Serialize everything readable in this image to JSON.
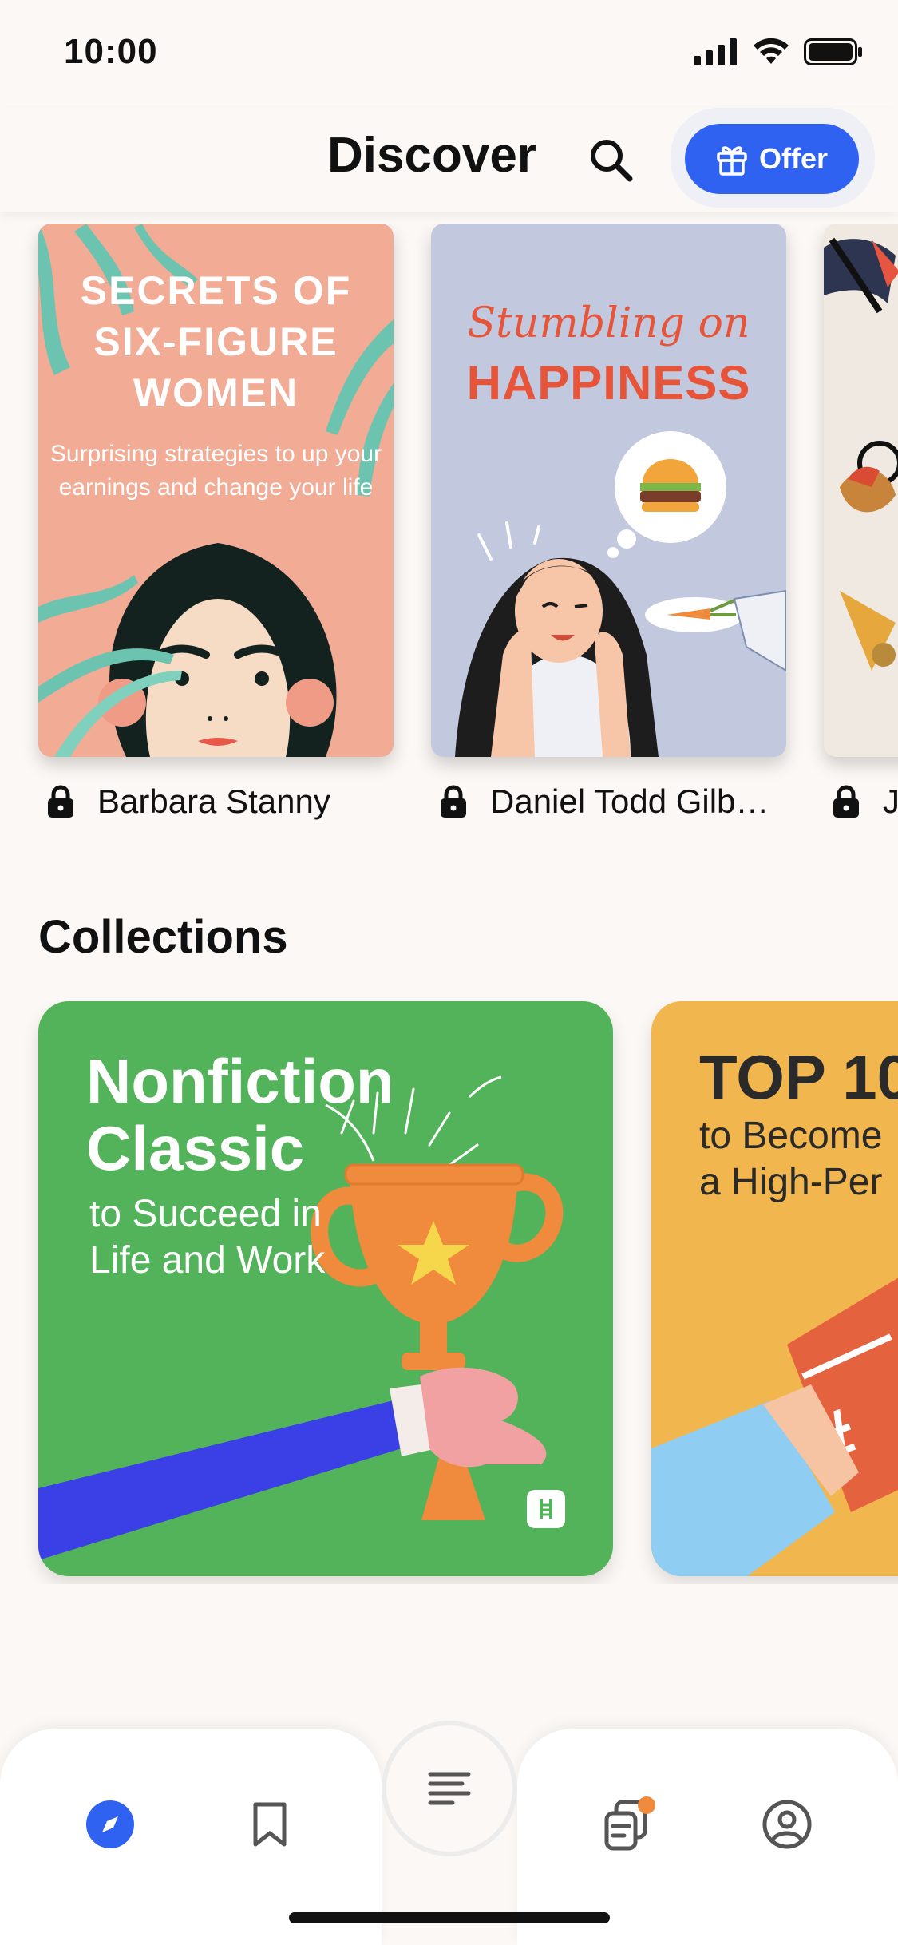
{
  "status_bar": {
    "time": "10:00"
  },
  "header": {
    "title": "Discover",
    "offer_label": "Offer"
  },
  "books": [
    {
      "author": "Barbara Stanny",
      "cover_title": "SECRETS OF SIX-FIGURE WOMEN",
      "cover_subtitle": "Surprising strategies to up your earnings and change your life"
    },
    {
      "author": "Daniel Todd Gilb…",
      "cover_title_line1": "Stumbling on",
      "cover_title_line2": "HAPPINESS"
    },
    {
      "author": "J"
    }
  ],
  "collections": {
    "title": "Collections",
    "items": [
      {
        "title_line1": "Nonfiction",
        "title_line2": "Classic",
        "subtitle": "to Succeed in Life and Work"
      },
      {
        "title": "TOP 10",
        "subtitle_line1": "to Become",
        "subtitle_line2": "a High-Per"
      }
    ]
  },
  "colors": {
    "accent": "#2f62f0",
    "background": "#fcf8f5",
    "collection_green": "#53b35a",
    "collection_yellow": "#f2b64f",
    "notification_dot": "#f08a3c"
  },
  "bottom_nav": {
    "items": [
      {
        "icon": "compass-icon",
        "active": true
      },
      {
        "icon": "bookmark-icon",
        "active": false
      },
      {
        "icon": "menu-lines-icon",
        "active": false
      },
      {
        "icon": "notes-icon",
        "active": false,
        "badge": true
      },
      {
        "icon": "profile-icon",
        "active": false
      }
    ]
  }
}
